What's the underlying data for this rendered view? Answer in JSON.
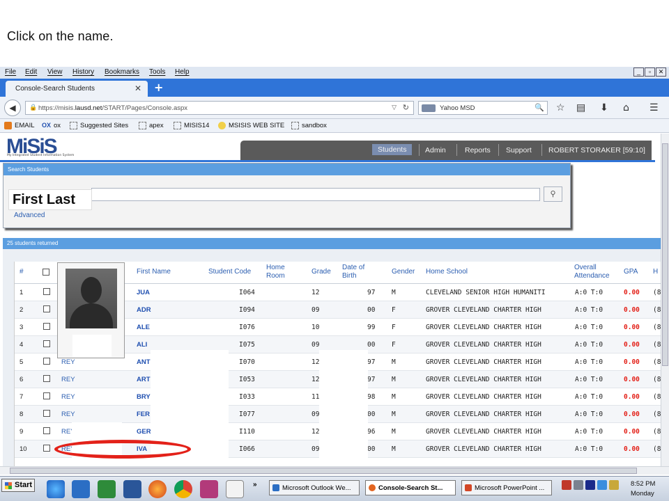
{
  "slide": {
    "caption": "Click on the name."
  },
  "browser": {
    "menu": [
      "File",
      "Edit",
      "View",
      "History",
      "Bookmarks",
      "Tools",
      "Help"
    ],
    "window_controls": [
      "_",
      "▫",
      "✕"
    ],
    "tab_title": "Console-Search Students",
    "tab_close": "✕",
    "new_tab": "+",
    "url_prefix": "https://misis.",
    "url_domain": "lausd.net",
    "url_path": "/START/Pages/Console.aspx",
    "search_engine_text": "Yahoo MSD",
    "bookmarks": [
      "EMAIL",
      "ox",
      "Suggested Sites",
      "apex",
      "MISIS14",
      "MSISIS WEB SITE",
      "sandbox"
    ],
    "bookmark_ox_icon": "OX"
  },
  "app": {
    "logo_text": "MiSiS",
    "logo_tagline": "My Integrated Student Information System",
    "nav": [
      "Students",
      "Admin",
      "Reports",
      "Support",
      "ROBERT STORAKER [59:10]"
    ],
    "search_panel_title": "Search Students",
    "search_hint": "First Last",
    "advanced_link": "Advanced",
    "results_title": "25 students returned"
  },
  "table": {
    "headers": {
      "num": "#",
      "first_name": "First Name",
      "student_code": "Student Code",
      "home_room": "Home Room",
      "grade": "Grade",
      "dob": "Date of Birth",
      "gender": "Gender",
      "home_school": "Home School",
      "attendance": "Overall Attendance",
      "gpa": "GPA",
      "h": "H"
    },
    "rows": [
      {
        "num": "1",
        "last": "",
        "first": "JUA",
        "code": "I064",
        "grade": "12",
        "dob": "97",
        "gender": "M",
        "school": "CLEVELAND SENIOR HIGH HUMANITI",
        "att": "A:0 T:0",
        "gpa": "0.00",
        "h": "(8"
      },
      {
        "num": "2",
        "last": "",
        "first": "ADR",
        "code": "I094",
        "grade": "09",
        "dob": "00",
        "gender": "F",
        "school": "GROVER CLEVELAND CHARTER HIGH",
        "att": "A:0 T:0",
        "gpa": "0.00",
        "h": "(8"
      },
      {
        "num": "3",
        "last": "",
        "first": "ALE",
        "code": "I076",
        "grade": "10",
        "dob": "99",
        "gender": "F",
        "school": "GROVER CLEVELAND CHARTER HIGH",
        "att": "A:0 T:0",
        "gpa": "0.00",
        "h": "(8"
      },
      {
        "num": "4",
        "last": "",
        "first": "ALI",
        "code": "I075",
        "grade": "09",
        "dob": "00",
        "gender": "F",
        "school": "GROVER CLEVELAND CHARTER HIGH",
        "att": "A:0 T:0",
        "gpa": "0.00",
        "h": "(8"
      },
      {
        "num": "5",
        "last": "REY",
        "first": "ANT",
        "code": "I070",
        "grade": "12",
        "dob": "97",
        "gender": "M",
        "school": "GROVER CLEVELAND CHARTER HIGH",
        "att": "A:0 T:0",
        "gpa": "0.00",
        "h": "(8"
      },
      {
        "num": "6",
        "last": "REY",
        "first": "ART",
        "code": "I053",
        "grade": "12",
        "dob": "97",
        "gender": "M",
        "school": "GROVER CLEVELAND CHARTER HIGH",
        "att": "A:0 T:0",
        "gpa": "0.00",
        "h": "(8"
      },
      {
        "num": "7",
        "last": "REY",
        "first": "BRY",
        "code": "I033",
        "grade": "11",
        "dob": "98",
        "gender": "M",
        "school": "GROVER CLEVELAND CHARTER HIGH",
        "att": "A:0 T:0",
        "gpa": "0.00",
        "h": "(8"
      },
      {
        "num": "8",
        "last": "REY",
        "first": "FER",
        "code": "I077",
        "grade": "09",
        "dob": "00",
        "gender": "M",
        "school": "GROVER CLEVELAND CHARTER HIGH",
        "att": "A:0 T:0",
        "gpa": "0.00",
        "h": "(8"
      },
      {
        "num": "9",
        "last": "REY",
        "first": "GER",
        "code": "I110",
        "grade": "12",
        "dob": "96",
        "gender": "M",
        "school": "GROVER CLEVELAND CHARTER HIGH",
        "att": "A:0 T:0",
        "gpa": "0.00",
        "h": "(8"
      },
      {
        "num": "10",
        "last": "REY",
        "first": "IVA",
        "code": "I066",
        "grade": "09",
        "dob": "00",
        "gender": "M",
        "school": "GROVER CLEVELAND CHARTER HIGH",
        "att": "A:0 T:0",
        "gpa": "0.00",
        "h": "(8"
      }
    ]
  },
  "taskbar": {
    "start": "Start",
    "overflow": "»",
    "tasks": [
      "Microsoft Outlook We...",
      "Console-Search St...",
      "Microsoft PowerPoint ..."
    ],
    "clock_time": "8:52 PM",
    "clock_day": "Monday"
  },
  "colors": {
    "accent": "#2f74d8",
    "gpa_red": "#e32119",
    "annotation": "#e32119",
    "nav_bg": "#5a5a5a"
  }
}
